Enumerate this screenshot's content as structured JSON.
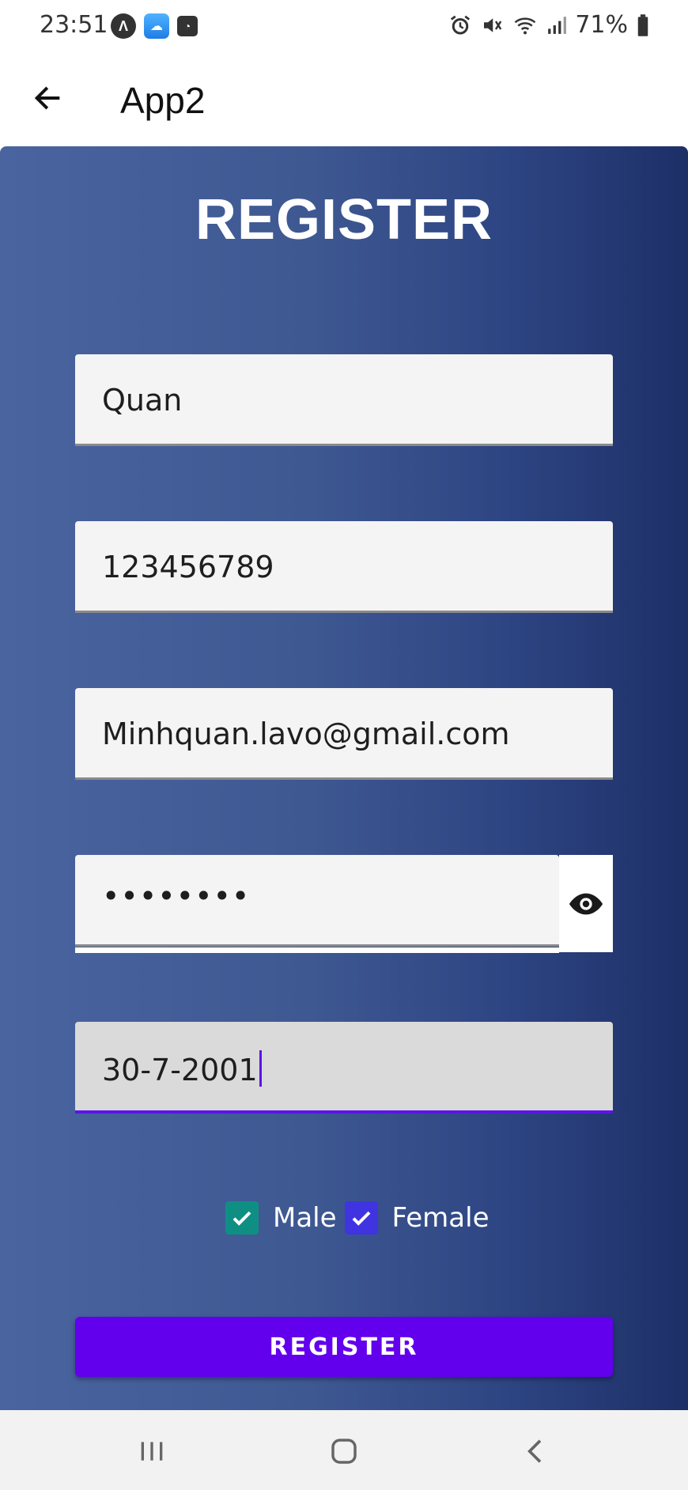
{
  "status_bar": {
    "time": "23:51",
    "left_icons": [
      "app-a-icon",
      "cloud-upload-icon",
      "clock-app-icon"
    ],
    "right_icons": [
      "alarm-icon",
      "mute-icon",
      "wifi-icon",
      "signal-icon"
    ],
    "battery": "71%"
  },
  "app_bar": {
    "title": "App2",
    "back_icon": "arrow-left-icon"
  },
  "form": {
    "title": "REGISTER",
    "name_value": "Quan",
    "phone_value": "123456789",
    "email_value": "Minhquan.lavo@gmail.com",
    "password_value": "••••••••",
    "password_toggle_icon": "eye-icon",
    "dob_value": "30-7-2001",
    "gender": {
      "male_label": "Male",
      "male_checked": true,
      "female_label": "Female",
      "female_checked": true
    },
    "submit_label": "REGISTER"
  },
  "colors": {
    "accent": "#6200ee",
    "male_check": "#0f8f84",
    "female_check": "#3f34e0",
    "panel_left": "#4a64a0",
    "panel_right": "#1d2f67"
  },
  "nav_bar": {
    "items": [
      "recent-apps-icon",
      "home-icon",
      "back-icon"
    ]
  }
}
